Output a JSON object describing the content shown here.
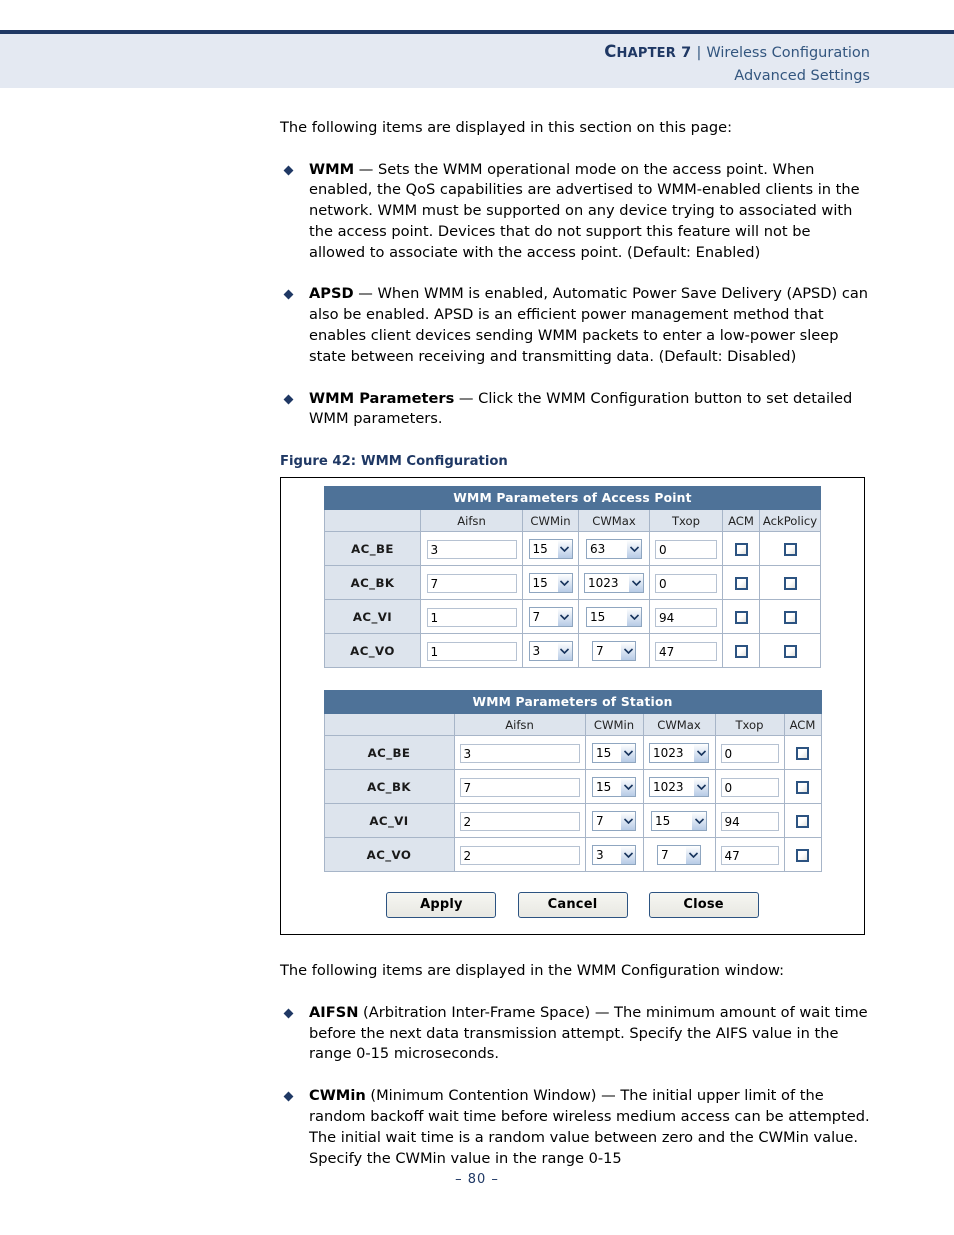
{
  "header": {
    "chapter_label": "Chapter 7",
    "chapter_c": "C",
    "chapter_rest": "HAPTER",
    "chapter_num": " 7",
    "separator": "|",
    "title": "Wireless Configuration",
    "subtitle": "Advanced Settings"
  },
  "intro": "The following items are displayed in this section on this page:",
  "bullets": [
    {
      "term": "WMM",
      "text": " — Sets the WMM operational mode on the access point. When enabled, the QoS capabilities are advertised to WMM-enabled clients in the network. WMM must be supported on any device trying to associated with the access point. Devices that do not support this feature will not be allowed to associate with the access point. (Default: Enabled)"
    },
    {
      "term": "APSD",
      "text": " — When WMM is enabled, Automatic Power Save Delivery (APSD) can also be enabled. APSD is an efficient power management method that enables client devices sending WMM packets to enter a low-power sleep state between receiving and transmitting data. (Default: Disabled)"
    },
    {
      "term": "WMM Parameters",
      "text": " — Click the WMM Configuration button to set detailed WMM parameters."
    }
  ],
  "figure": {
    "caption_label": "Figure 42:",
    "caption_title": "WMM Configuration",
    "ap_table": {
      "title": "WMM Parameters of Access Point",
      "columns": [
        "",
        "Aifsn",
        "CWMin",
        "CWMax",
        "Txop",
        "ACM",
        "AckPolicy"
      ],
      "rows": [
        {
          "name": "AC_BE",
          "aifsn": "3",
          "cwmin": "15",
          "cwmax": "63",
          "txop": "0",
          "acm": false,
          "ackpolicy": false
        },
        {
          "name": "AC_BK",
          "aifsn": "7",
          "cwmin": "15",
          "cwmax": "1023",
          "txop": "0",
          "acm": false,
          "ackpolicy": false
        },
        {
          "name": "AC_VI",
          "aifsn": "1",
          "cwmin": "7",
          "cwmax": "15",
          "txop": "94",
          "acm": false,
          "ackpolicy": false
        },
        {
          "name": "AC_VO",
          "aifsn": "1",
          "cwmin": "3",
          "cwmax": "7",
          "txop": "47",
          "acm": false,
          "ackpolicy": false
        }
      ]
    },
    "station_table": {
      "title": "WMM Parameters of Station",
      "columns": [
        "",
        "Aifsn",
        "CWMin",
        "CWMax",
        "Txop",
        "ACM"
      ],
      "rows": [
        {
          "name": "AC_BE",
          "aifsn": "3",
          "cwmin": "15",
          "cwmax": "1023",
          "txop": "0",
          "acm": false
        },
        {
          "name": "AC_BK",
          "aifsn": "7",
          "cwmin": "15",
          "cwmax": "1023",
          "txop": "0",
          "acm": false
        },
        {
          "name": "AC_VI",
          "aifsn": "2",
          "cwmin": "7",
          "cwmax": "15",
          "txop": "94",
          "acm": false
        },
        {
          "name": "AC_VO",
          "aifsn": "2",
          "cwmin": "3",
          "cwmax": "7",
          "txop": "47",
          "acm": false
        }
      ]
    },
    "buttons": {
      "apply": "Apply",
      "cancel": "Cancel",
      "close": "Close"
    }
  },
  "intro2": "The following items are displayed in the WMM Configuration window:",
  "bullets2": [
    {
      "term": "AIFSN",
      "text": " (Arbitration Inter-Frame Space) — The minimum amount of wait time before the next data transmission attempt. Specify the AIFS value in the range 0-15 microseconds."
    },
    {
      "term": "CWMin",
      "text": " (Minimum Contention Window) — The initial upper limit of the random backoff wait time before wireless medium access can be attempted. The initial wait time is a random value between zero and the CWMin value. Specify the CWMin value in the range 0-15"
    }
  ],
  "footer": {
    "page_number": "–  80  –"
  },
  "colors": {
    "navy": "#1f3864",
    "header_band": "#e4e9f2",
    "table_title_bg": "#4e7298",
    "cell_bg": "#dde4ed"
  }
}
